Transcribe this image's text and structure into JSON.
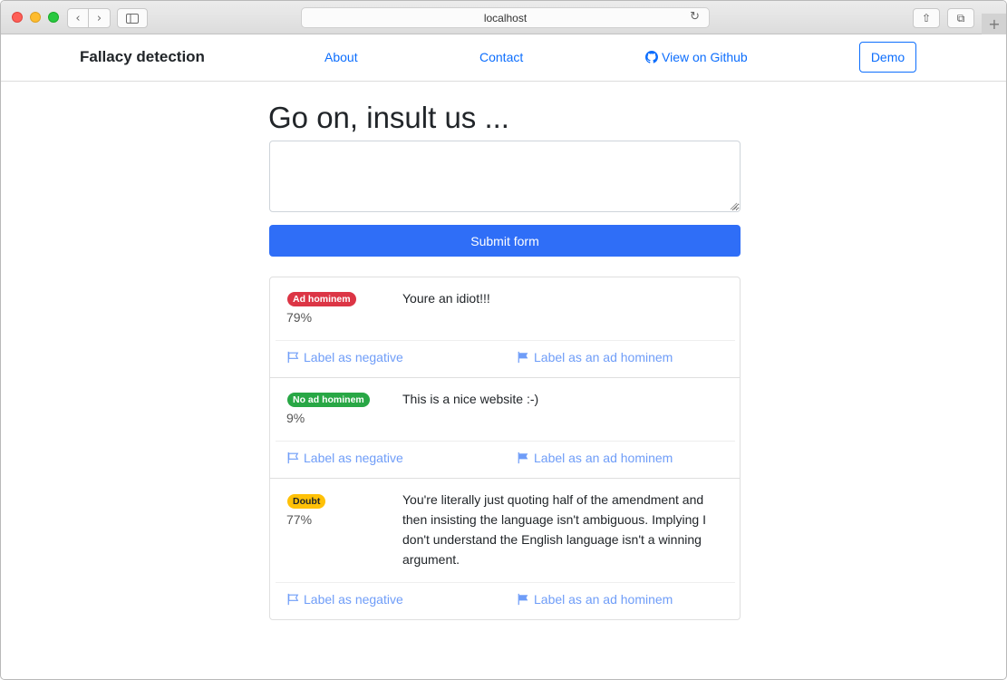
{
  "browser": {
    "url": "localhost",
    "back_glyph": "‹",
    "forward_glyph": "›",
    "reload_glyph": "↻",
    "share_glyph": "⇧",
    "tabs_glyph": "⧉",
    "newtab_glyph": "+"
  },
  "navbar": {
    "brand": "Fallacy detection",
    "about": "About",
    "contact": "Contact",
    "github": "View on Github",
    "demo": "Demo"
  },
  "main": {
    "heading": "Go on, insult us ...",
    "textarea_value": "",
    "submit_label": "Submit form"
  },
  "colors": {
    "primary": "#0d6efd",
    "badge_adhominem": "#dc3545",
    "badge_no_adhominem": "#28a745",
    "badge_doubt": "#ffc107"
  },
  "results": [
    {
      "badge": "Ad hominem",
      "badge_type": "danger",
      "percent": "79%",
      "text": "Youre an idiot!!!",
      "action_negative": "Label as negative",
      "action_adhominem": "Label as an ad hominem"
    },
    {
      "badge": "No ad hominem",
      "badge_type": "success",
      "percent": "9%",
      "text": "This is a nice website :-)",
      "action_negative": "Label as negative",
      "action_adhominem": "Label as an ad hominem"
    },
    {
      "badge": "Doubt",
      "badge_type": "warning",
      "percent": "77%",
      "text": "You're literally just quoting half of the amendment and then insisting the language isn't ambiguous. Implying I don't understand the English language isn't a winning argument.",
      "action_negative": "Label as negative",
      "action_adhominem": "Label as an ad hominem"
    }
  ]
}
